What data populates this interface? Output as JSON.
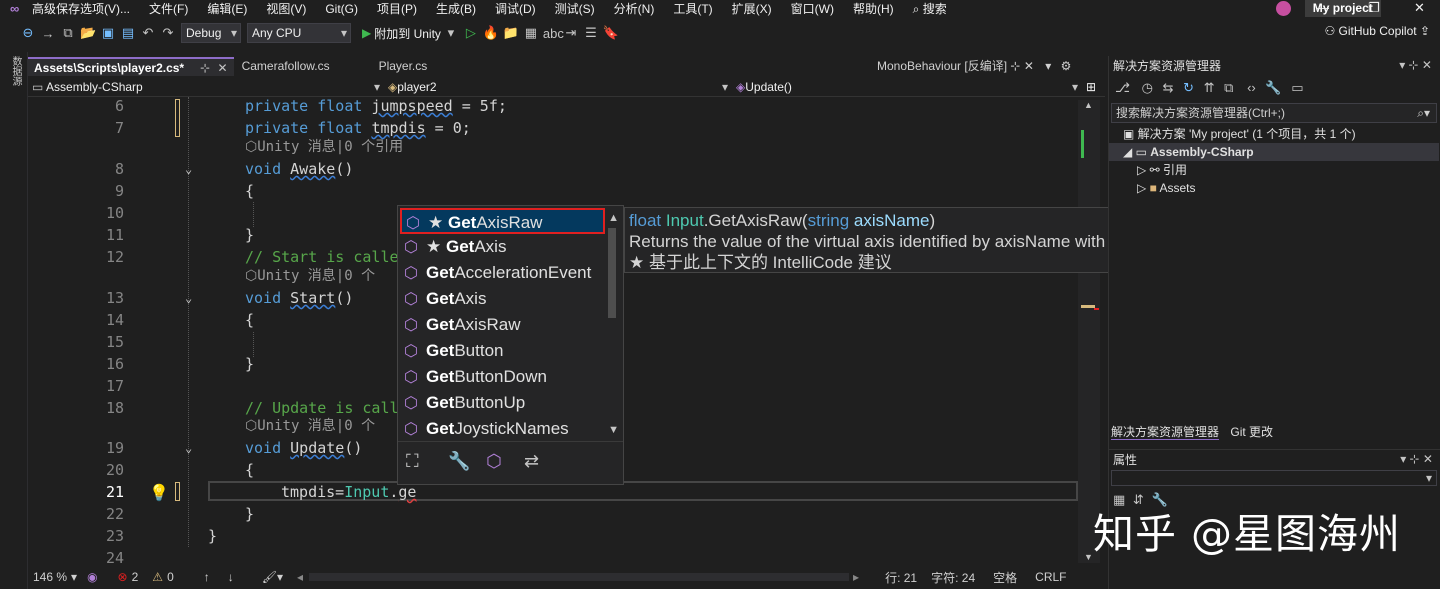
{
  "menubar": {
    "items": [
      "高级保存选项(V)...",
      "文件(F)",
      "编辑(E)",
      "视图(V)",
      "Git(G)",
      "项目(P)",
      "生成(B)",
      "调试(D)",
      "测试(S)",
      "分析(N)",
      "工具(T)",
      "扩展(X)",
      "窗口(W)",
      "帮助(H)"
    ],
    "search": "搜索",
    "project": "My project"
  },
  "toolbar": {
    "config": "Debug",
    "platform": "Any CPU",
    "run_label": "附加到 Unity",
    "copilot": "GitHub Copilot"
  },
  "left_strip": {
    "label": "数据源"
  },
  "tabs": [
    {
      "label": "Assets\\Scripts\\player2.cs*",
      "active": true
    },
    {
      "label": "Camerafollow.cs",
      "active": false
    },
    {
      "label": "Player.cs",
      "active": false
    }
  ],
  "tab_right": "MonoBehaviour [反编译]",
  "navbar": {
    "project": "Assembly-CSharp",
    "class": "player2",
    "member": "Update()"
  },
  "code_lines": [
    {
      "n": "6",
      "text": "private float jumpspeed = 5f;"
    },
    {
      "n": "7",
      "text": "private float tmpdis = 0;"
    },
    {
      "n": "8",
      "text": "void Awake()"
    },
    {
      "n": "9",
      "text": "{"
    },
    {
      "n": "10",
      "text": ""
    },
    {
      "n": "11",
      "text": "}"
    },
    {
      "n": "12",
      "text": "// Start is calle"
    },
    {
      "n": "13",
      "text": "void Start()"
    },
    {
      "n": "14",
      "text": "{"
    },
    {
      "n": "15",
      "text": ""
    },
    {
      "n": "16",
      "text": "}"
    },
    {
      "n": "17",
      "text": ""
    },
    {
      "n": "18",
      "text": "// Update is call"
    },
    {
      "n": "19",
      "text": "void Update()"
    },
    {
      "n": "20",
      "text": "{"
    },
    {
      "n": "21",
      "text": "tmpdis=Input.ge"
    },
    {
      "n": "22",
      "text": "}"
    },
    {
      "n": "23",
      "text": "}"
    },
    {
      "n": "24",
      "text": ""
    }
  ],
  "code_lens": [
    "Unity 消息|0 个引用",
    "Unity 消息|0 个",
    "Unity 消息|0 个"
  ],
  "completion": {
    "items": [
      {
        "match": "Get",
        "rest": "AxisRaw",
        "starred": true,
        "selected": true
      },
      {
        "match": "Get",
        "rest": "Axis",
        "starred": true,
        "selected": false
      },
      {
        "match": "Get",
        "rest": "AccelerationEvent",
        "starred": false,
        "selected": false
      },
      {
        "match": "Get",
        "rest": "Axis",
        "starred": false,
        "selected": false
      },
      {
        "match": "Get",
        "rest": "AxisRaw",
        "starred": false,
        "selected": false
      },
      {
        "match": "Get",
        "rest": "Button",
        "starred": false,
        "selected": false
      },
      {
        "match": "Get",
        "rest": "ButtonDown",
        "starred": false,
        "selected": false
      },
      {
        "match": "Get",
        "rest": "ButtonUp",
        "starred": false,
        "selected": false
      },
      {
        "match": "Get",
        "rest": "JoystickNames",
        "starred": false,
        "selected": false
      }
    ],
    "star": "★"
  },
  "tooltip": {
    "sig_type": "float",
    "sig_class": "Input",
    "sig_method": ".GetAxisRaw(",
    "sig_ptype": "string",
    "sig_pname": "axisName",
    "sig_close": ")",
    "description": "Returns the value of the virtual axis identified by axisName with no smoothing filtering applied.",
    "intellicode": "★  基于此上下文的 IntelliCode 建议"
  },
  "statusbar": {
    "zoom": "146 %",
    "errors": "2",
    "warnings": "0",
    "line": "行: 21",
    "col": "字符: 24",
    "spacing": "空格",
    "eol": "CRLF"
  },
  "solution_explorer": {
    "title": "解决方案资源管理器",
    "search_placeholder": "搜索解决方案资源管理器(Ctrl+;)",
    "solution": "解决方案 'My project' (1 个项目，共 1 个)",
    "project": "Assembly-CSharp",
    "references": "引用",
    "assets": "Assets",
    "bottom_tab1": "解决方案资源管理器",
    "bottom_tab2": "Git 更改"
  },
  "properties": {
    "title": "属性"
  },
  "watermark": "知乎 @星图海州",
  "colors": {
    "accent": "#8e6dc9",
    "error": "#e02020",
    "keyword": "#569cd6",
    "comment": "#57a64a",
    "type": "#4ec9b0"
  }
}
